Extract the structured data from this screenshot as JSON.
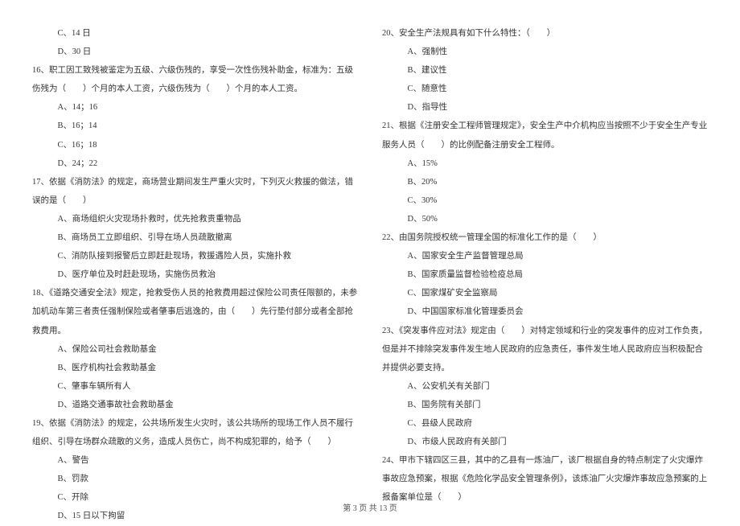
{
  "left": {
    "q15_optC": "C、14 日",
    "q15_optD": "D、30 日",
    "q16_text": "16、职工因工致残被鉴定为五级、六级伤残的，享受一次性伤残补助金，标准为：五级伤残为（　　）个月的本人工资，六级伤残为（　　）个月的本人工资。",
    "q16_optA": "A、14；16",
    "q16_optB": "B、16；14",
    "q16_optC": "C、16；18",
    "q16_optD": "D、24；22",
    "q17_text": "17、依据《消防法》的规定，商场营业期间发生严重火灾时，下列灭火救援的做法，错误的是（　　）",
    "q17_optA": "A、商场组织火灾现场扑救时，优先抢救贵重物品",
    "q17_optB": "B、商场员工立即组织、引导在场人员疏散撤离",
    "q17_optC": "C、消防队接到报警后立即赶赴现场，救援遇险人员，实施扑救",
    "q17_optD": "D、医疗单位及时赶赴现场，实施伤员救治",
    "q18_text": "18、《道路交通安全法》规定，抢救受伤人员的抢救费用超过保险公司责任限额的，未参加机动车第三者责任强制保险或者肇事后逃逸的，由（　　）先行垫付部分或者全部抢救费用。",
    "q18_optA": "A、保险公司社会救助基金",
    "q18_optB": "B、医疗机构社会救助基金",
    "q18_optC": "C、肇事车辆所有人",
    "q18_optD": "D、道路交通事故社会救助基金",
    "q19_text": "19、依据《消防法》的规定，公共场所发生火灾时，该公共场所的现场工作人员不履行组织、引导在场群众疏散的义务，造成人员伤亡，尚不构成犯罪的，给予（　　）",
    "q19_optA": "A、警告",
    "q19_optB": "B、罚款",
    "q19_optC": "C、开除",
    "q19_optD": "D、15 日以下拘留"
  },
  "right": {
    "q20_text": "20、安全生产法规具有如下什么特性：（　　）",
    "q20_optA": "A、强制性",
    "q20_optB": "B、建议性",
    "q20_optC": "C、随意性",
    "q20_optD": "D、指导性",
    "q21_text": "21、根据《注册安全工程师管理规定》，安全生产中介机构应当按照不少于安全生产专业服务人员（　　）的比例配备注册安全工程师。",
    "q21_optA": "A、15%",
    "q21_optB": "B、20%",
    "q21_optC": "C、30%",
    "q21_optD": "D、50%",
    "q22_text": "22、由国务院授权统一管理全国的标准化工作的是（　　）",
    "q22_optA": "A、国家安全生产监督管理总局",
    "q22_optB": "B、国家质量监督检验检疫总局",
    "q22_optC": "C、国家煤矿安全监察局",
    "q22_optD": "D、中国国家标准化管理委员会",
    "q23_text": "23、《突发事件应对法》规定由（　　）对特定领域和行业的突发事件的应对工作负责，但是并不排除突发事件发生地人民政府的应急责任，事件发生地人民政府应当积极配合并提供必要支持。",
    "q23_optA": "A、公安机关有关部门",
    "q23_optB": "B、国务院有关部门",
    "q23_optC": "C、县级人民政府",
    "q23_optD": "D、市级人民政府有关部门",
    "q24_text": "24、甲市下辖四区三县，其中的乙县有一炼油厂，该厂根据自身的特点制定了火灾爆炸事故应急预案，根据《危险化学品安全管理条例》，该炼油厂火灾爆炸事故应急预案的上报备案单位是（　　）"
  },
  "footer": "第 3 页 共 13 页"
}
